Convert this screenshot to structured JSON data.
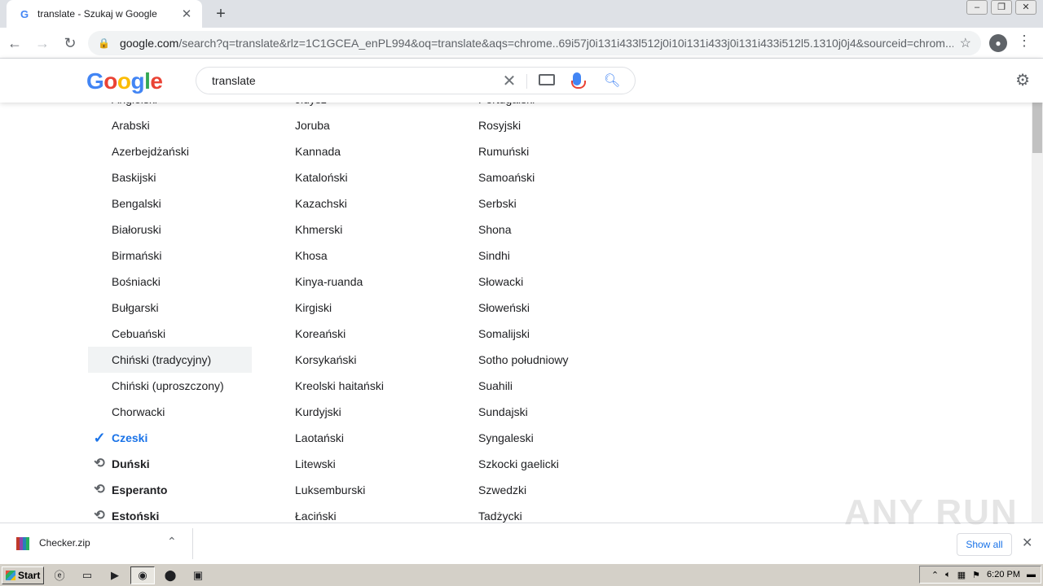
{
  "browser": {
    "tab_title": "translate - Szukaj w Google",
    "tab_favicon": "G",
    "url_host": "google.com",
    "url_rest": "/search?q=translate&rlz=1C1GCEA_enPL994&oq=translate&aqs=chrome..69i57j0i131i433l512j0i10i131i433j0i131i433i512l5.1310j0j4&sourceid=chrom..."
  },
  "google": {
    "logo": [
      "G",
      "o",
      "o",
      "g",
      "l",
      "e"
    ],
    "query": "translate"
  },
  "languages": {
    "col1": [
      {
        "label": "Angielski",
        "state": "normal"
      },
      {
        "label": "Arabski",
        "state": "normal"
      },
      {
        "label": "Azerbejdżański",
        "state": "normal"
      },
      {
        "label": "Baskijski",
        "state": "normal"
      },
      {
        "label": "Bengalski",
        "state": "normal"
      },
      {
        "label": "Białoruski",
        "state": "normal"
      },
      {
        "label": "Birmański",
        "state": "normal"
      },
      {
        "label": "Bośniacki",
        "state": "normal"
      },
      {
        "label": "Bułgarski",
        "state": "normal"
      },
      {
        "label": "Cebuański",
        "state": "normal"
      },
      {
        "label": "Chiński (tradycyjny)",
        "state": "highlight"
      },
      {
        "label": "Chiński (uproszczony)",
        "state": "normal"
      },
      {
        "label": "Chorwacki",
        "state": "normal"
      },
      {
        "label": "Czeski",
        "state": "selected"
      },
      {
        "label": "Duński",
        "state": "recent"
      },
      {
        "label": "Esperanto",
        "state": "recent"
      },
      {
        "label": "Estoński",
        "state": "recent"
      }
    ],
    "col2": [
      "Jidysz",
      "Joruba",
      "Kannada",
      "Kataloński",
      "Kazachski",
      "Khmerski",
      "Khosa",
      "Kinya-ruanda",
      "Kirgiski",
      "Koreański",
      "Korsykański",
      "Kreolski haitański",
      "Kurdyjski",
      "Laotański",
      "Litewski",
      "Luksemburski",
      "Łaciński"
    ],
    "col3": [
      "Portugalski",
      "Rosyjski",
      "Rumuński",
      "Samoański",
      "Serbski",
      "Shona",
      "Sindhi",
      "Słowacki",
      "Słoweński",
      "Somalijski",
      "Sotho południowy",
      "Suahili",
      "Sundajski",
      "Syngaleski",
      "Szkocki gaelicki",
      "Szwedzki",
      "Tadżycki"
    ]
  },
  "download_bar": {
    "file_name": "Checker.zip",
    "show_all": "Show all"
  },
  "watermark": "ANY RUN",
  "taskbar": {
    "start_label": "Start",
    "clock": "6:20 PM"
  },
  "colors": {
    "accent": "#1a73e8",
    "highlight_bg": "#f1f3f4"
  }
}
